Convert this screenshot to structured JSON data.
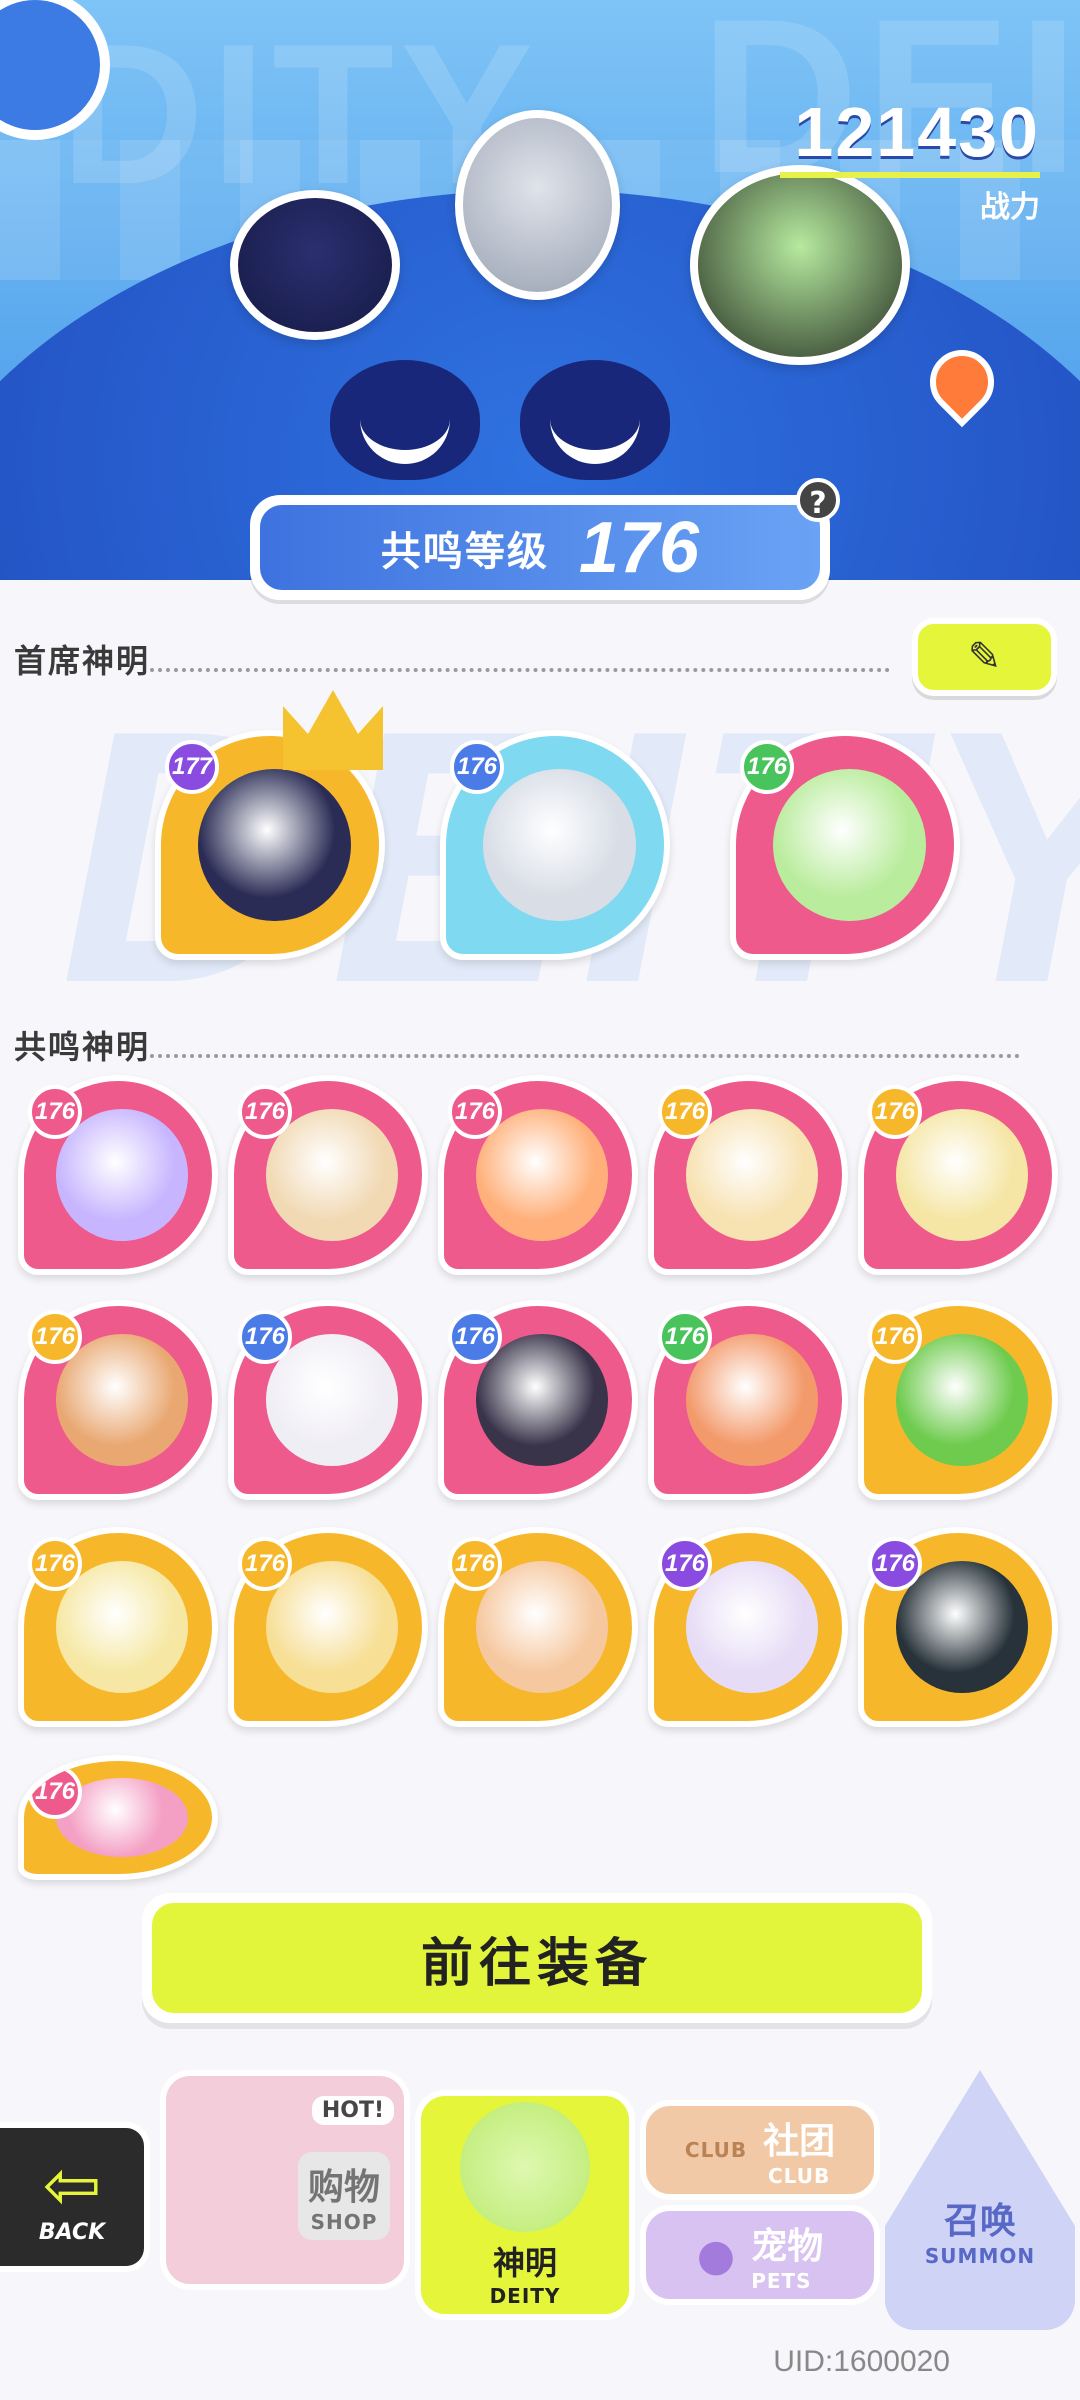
{
  "header": {
    "bg_word_left": "DITY",
    "bg_word_right": "DEI",
    "power_value": "121430",
    "power_label": "战力",
    "resonance_label": "共鸣等级",
    "resonance_value": "176",
    "help_label": "?"
  },
  "sections": {
    "chief_title": "首席神明",
    "resonance_title": "共鸣神明",
    "bg_word": "DEITY",
    "edit_icon": "✎"
  },
  "chief_deities": [
    {
      "level": "177",
      "frame": "#f7b72b",
      "badge": "#8a4ce0",
      "face": "#2a2c55",
      "crown": true
    },
    {
      "level": "176",
      "frame": "#7fd9f0",
      "badge": "#4b7be6",
      "face": "#d8dde6"
    },
    {
      "level": "176",
      "frame": "#ee5a8b",
      "badge": "#49c35b",
      "face": "#b9ec9c"
    }
  ],
  "resonance_deities": [
    {
      "level": "176",
      "frame": "#ee5a8b",
      "badge": "#ee5a8b",
      "face": "#c7b6ff"
    },
    {
      "level": "176",
      "frame": "#ee5a8b",
      "badge": "#ee5a8b",
      "face": "#f1d9b4"
    },
    {
      "level": "176",
      "frame": "#ee5a8b",
      "badge": "#ee5a8b",
      "face": "#ffb07a"
    },
    {
      "level": "176",
      "frame": "#ee5a8b",
      "badge": "#f7b72b",
      "face": "#f7e2b2"
    },
    {
      "level": "176",
      "frame": "#ee5a8b",
      "badge": "#f7b72b",
      "face": "#f5e6a5"
    },
    {
      "level": "176",
      "frame": "#ee5a8b",
      "badge": "#f7b72b",
      "face": "#e9a872"
    },
    {
      "level": "176",
      "frame": "#ee5a8b",
      "badge": "#4b7be6",
      "face": "#f0eef5"
    },
    {
      "level": "176",
      "frame": "#ee5a8b",
      "badge": "#4b7be6",
      "face": "#39344a"
    },
    {
      "level": "176",
      "frame": "#ee5a8b",
      "badge": "#49c35b",
      "face": "#f39a6b"
    },
    {
      "level": "176",
      "frame": "#f7b72b",
      "badge": "#f7b72b",
      "face": "#6ecb4d"
    },
    {
      "level": "176",
      "frame": "#f7b72b",
      "badge": "#f7b72b",
      "face": "#f6e8a4"
    },
    {
      "level": "176",
      "frame": "#f7b72b",
      "badge": "#f7b72b",
      "face": "#f7df96"
    },
    {
      "level": "176",
      "frame": "#f7b72b",
      "badge": "#f7b72b",
      "face": "#f6c89f"
    },
    {
      "level": "176",
      "frame": "#f7b72b",
      "badge": "#8a4ce0",
      "face": "#e6dcf6"
    },
    {
      "level": "176",
      "frame": "#f7b72b",
      "badge": "#8a4ce0",
      "face": "#27323a"
    },
    {
      "level": "176",
      "frame": "#f7b72b",
      "badge": "#ee5a8b",
      "face": "#f4a0c4"
    }
  ],
  "equip_button": "前往装备",
  "nav": {
    "back_en": "BACK",
    "shop_badge": "HOT!",
    "shop_zh": "购物",
    "shop_en": "SHOP",
    "deity_zh": "神明",
    "deity_en": "DEITY",
    "club_zh": "社团",
    "club_en": "CLUB",
    "club_tag": "CLUB",
    "pets_zh": "宠物",
    "pets_en": "PETS",
    "summon_zh": "召唤",
    "summon_en": "SUMMON"
  },
  "uid": "UID:1600020"
}
